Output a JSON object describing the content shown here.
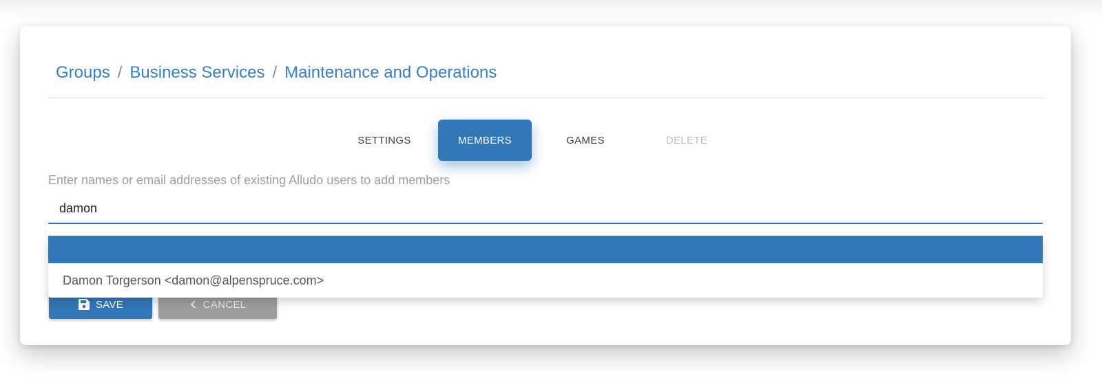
{
  "breadcrumb": {
    "items": [
      {
        "label": "Groups"
      },
      {
        "label": "Business Services"
      },
      {
        "label": "Maintenance and Operations"
      }
    ],
    "separator": "/"
  },
  "tabs": [
    {
      "label": "SETTINGS",
      "state": "normal"
    },
    {
      "label": "MEMBERS",
      "state": "active"
    },
    {
      "label": "GAMES",
      "state": "normal"
    },
    {
      "label": "DELETE",
      "state": "disabled"
    }
  ],
  "members": {
    "helper_text": "Enter names or email addresses of existing Alludo users to add members",
    "search_value": "damon",
    "suggestions": [
      {
        "label": "Damon Torgerson <damon@alpenspruce.com>"
      }
    ]
  },
  "actions": {
    "save_label": "SAVE",
    "cancel_label": "CANCEL"
  },
  "colors": {
    "accent": "#3277b8",
    "link": "#3a7ec0",
    "disabled": "#bdbdbd",
    "cancel_bg": "#9e9e9e"
  },
  "icons": {
    "save": "floppy-disk-icon",
    "cancel": "chevron-left-icon"
  }
}
